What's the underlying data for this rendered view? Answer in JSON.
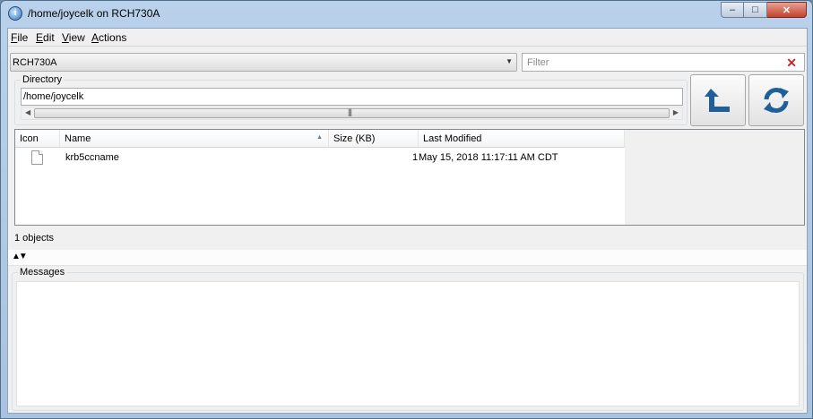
{
  "window": {
    "title": "/home/joycelk on RCH730A",
    "icon": "app-info-icon",
    "controls": {
      "minimize": "minimize-icon",
      "maximize": "maximize-icon",
      "close": "close-icon"
    }
  },
  "menu": {
    "items": [
      {
        "label": "File",
        "accel": "F",
        "rest": "ile"
      },
      {
        "label": "Edit",
        "accel": "E",
        "rest": "dit"
      },
      {
        "label": "View",
        "accel": "V",
        "rest": "iew"
      },
      {
        "label": "Actions",
        "accel": "A",
        "rest": "ctions"
      }
    ]
  },
  "system_select": {
    "value": "RCH730A"
  },
  "filter": {
    "placeholder": "Filter",
    "value": ""
  },
  "directory": {
    "legend": "Directory",
    "value": "/home/joycelk"
  },
  "toolbar": {
    "up_icon": "folder-up-icon",
    "refresh_icon": "refresh-icon"
  },
  "table": {
    "columns": [
      {
        "label": "Icon"
      },
      {
        "label": "Name",
        "sorted": "ascending"
      },
      {
        "label": "Size (KB)"
      },
      {
        "label": "Last Modified"
      }
    ],
    "rows": [
      {
        "icon": "file-icon",
        "name": "krb5ccname",
        "size": "1",
        "modified": "May 15, 2018 11:17:11 AM CDT"
      }
    ]
  },
  "status": {
    "text": "1 objects"
  },
  "messages": {
    "legend": "Messages",
    "content": ""
  },
  "colors": {
    "accent": "#1f5f9a",
    "filter_clear": "#c62b2b"
  }
}
